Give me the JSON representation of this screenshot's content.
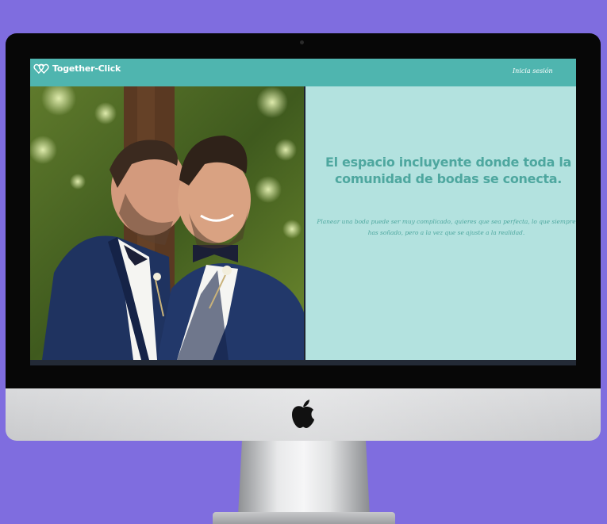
{
  "site": {
    "brand_name": "Together-Click",
    "brand_icon": "two-hearts-icon",
    "login_label": "Inicia sesión"
  },
  "hero": {
    "heading": "El espacio incluyente donde toda la comunidad de bodas se conecta.",
    "text_line_1": "Planear una boda puede ser muy complicado, quieres que sea perfecta, lo que siempre",
    "text_line_2": "has soñado, pero a la vez que se ajuste a la realidad.",
    "photo": "couple-wedding-photo"
  },
  "colors": {
    "page_background": "#7f6ddf",
    "header": "#4fb5af",
    "hero_panel": "#b3e2df",
    "accent_text": "#4ea79f"
  }
}
